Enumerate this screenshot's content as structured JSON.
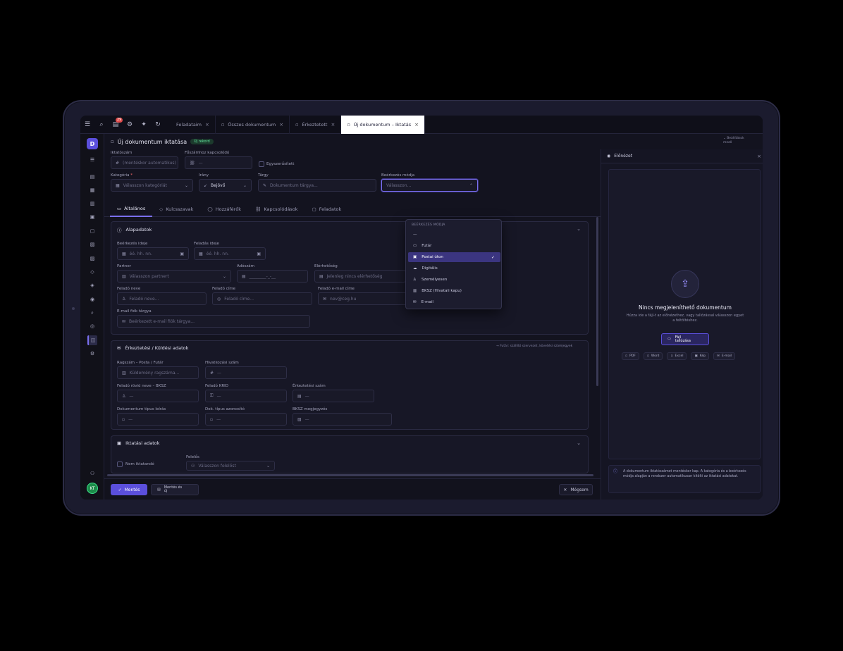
{
  "topbar": {
    "notification_count": "29",
    "tabs": [
      {
        "label": "Feladataim"
      },
      {
        "label": "Összes dokumentum"
      },
      {
        "label": "Érkeztetett"
      },
      {
        "label": "Új dokumentum – Iktatás"
      }
    ]
  },
  "header": {
    "title": "Új dokumentum iktatása",
    "status": "Új rekord",
    "right_hint": "⌄ Beállítások\nmező"
  },
  "form": {
    "ikt_label": "Iktatószám",
    "ikt_placeholder": "(mentéskor automatikus)",
    "foszam_label": "Főszámhoz kapcsolódó",
    "foszam_placeholder": "—",
    "egyszerusitett_label": "Egyszerűsített",
    "kategoria_label": "Kategória",
    "kategoria_placeholder": "Válasszon kategóriát",
    "irany_label": "Irány",
    "irany_value": "Bejövő",
    "targy_label": "Tárgy",
    "targy_placeholder": "Dokumentum tárgya...",
    "erkezes_label": "Beérkezés módja",
    "erkezes_placeholder": "Válasszon..."
  },
  "subtabs": [
    {
      "label": "Általános"
    },
    {
      "label": "Kulcsszavak"
    },
    {
      "label": "Hozzáférők"
    },
    {
      "label": "Kapcsolódások"
    },
    {
      "label": "Feladatok"
    }
  ],
  "alapadatok": {
    "title": "Alapadatok",
    "beerkezes_ideje_label": "Beérkezés ideje",
    "feladas_ideje_label": "Feladás ideje",
    "date_placeholder": "éé. hh. nn.",
    "partner_label": "Partner",
    "partner_placeholder": "Válasszon partnert",
    "adoszam_label": "Adószám",
    "adoszam_placeholder": "________-_-__",
    "elerhetoseg_label": "Elérhetőség",
    "elerhetoseg_placeholder": "Jelenleg nincs elérhetőség",
    "felado_neve_label": "Feladó neve",
    "felado_neve_placeholder": "Feladó neve...",
    "felado_cime_label": "Feladó címe",
    "felado_cime_placeholder": "Feladó címe...",
    "felado_email_label": "Feladó e-mail címe",
    "felado_email_placeholder": "nev@ceg.hu",
    "email_targy_label": "E-mail fiók tárgya",
    "email_targy_placeholder": "Beérkezett e-mail fiók tárgya..."
  },
  "erkeztetesi": {
    "title": "Érkeztetési / Küldési adatok",
    "hint": "→ Futár: szállító szervezet, követési számjegyek",
    "ragszam_label": "Ragszám – Posta / Futár",
    "ragszam_placeholder": "Küldemény ragszáma...",
    "hivatkozasi_label": "Hivatkozási szám",
    "hivatkozasi_placeholder": "—",
    "felado_rovid_label": "Feladó rövid neve – BKSZ",
    "felado_rovid_placeholder": "—",
    "felado_krid_label": "Feladó KRID",
    "felado_krid_placeholder": "—",
    "erkeztetesi_szam_label": "Érkeztetési szám",
    "erkeztetesi_szam_placeholder": "—",
    "dok_tipus_leiras_label": "Dokumentum típus leírás",
    "dok_tipus_leiras_placeholder": "—",
    "dok_tipus_azon_label": "Dok. típus azonosító",
    "dok_tipus_azon_placeholder": "—",
    "bksz_label": "BKSZ megjegyzés",
    "bksz_placeholder": "—"
  },
  "iktatasi": {
    "title": "Iktatási adatok",
    "nem_iktatando_label": "Nem iktatandó",
    "felelos_label": "Felelős",
    "felelos_placeholder": "Válasszon felelőst"
  },
  "dropdown": {
    "header": "BEÉRKEZÉS MÓDJA",
    "items": [
      {
        "label": "—",
        "selected": false
      },
      {
        "label": "Futár",
        "selected": false
      },
      {
        "label": "Postai úton",
        "selected": true
      },
      {
        "label": "Digitális",
        "selected": false
      },
      {
        "label": "Személyesen",
        "selected": false
      },
      {
        "label": "BKSZ (Hivatali kapu)",
        "selected": false
      },
      {
        "label": "E-mail",
        "selected": false
      }
    ]
  },
  "footer": {
    "save_label": "Mentés",
    "save_new_label": "Mentés és\núj",
    "cancel_label": "Mégsem"
  },
  "preview": {
    "title": "Előnézet",
    "empty_title": "Nincs megjeleníthető dokumentum",
    "empty_desc": "Húzza ide a fájl-t az előnézethez, vagy tallózással válasszon egyet a feltöltéshez.",
    "upload_label": "Fájl\ntallózása",
    "types": [
      {
        "label": "PDF"
      },
      {
        "label": "Word"
      },
      {
        "label": "Excel"
      },
      {
        "label": "Kép"
      },
      {
        "label": "E-mail"
      }
    ],
    "info": "A dokumentum iktatószámot mentéskor kap. A kategória és a beérkezés módja alapján a rendszer automatikusan kitölti az iktatási adatokat."
  },
  "user": {
    "initials": "KT"
  },
  "colors": {
    "accent": "#5b4fdc",
    "background": "#13131f"
  }
}
